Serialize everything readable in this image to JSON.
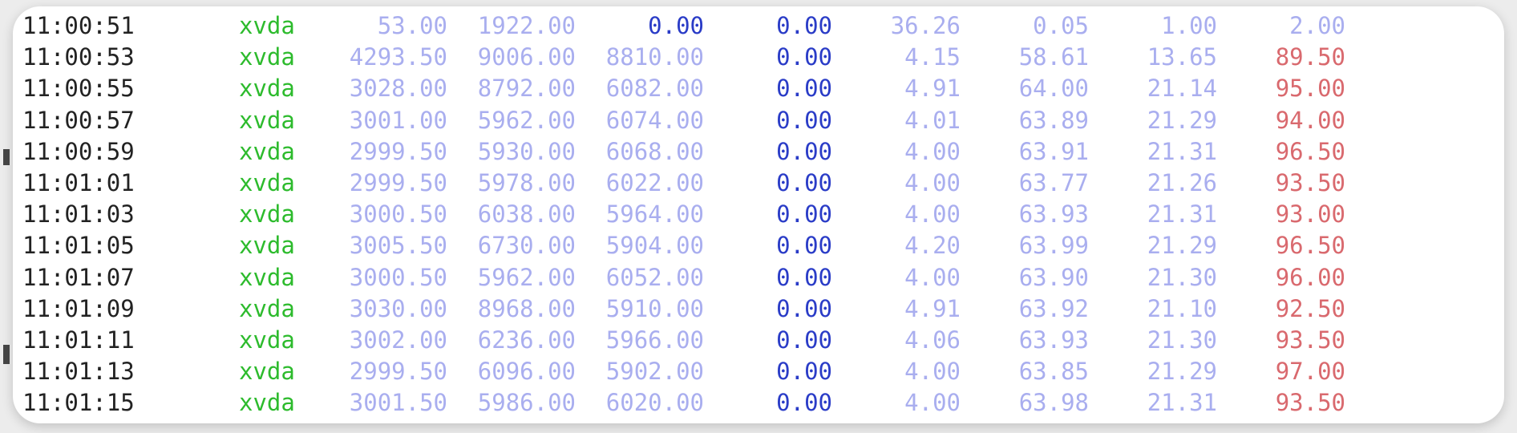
{
  "colors": {
    "time": "#222222",
    "device": "#2dbb2d",
    "dim": "#a9aeef",
    "accent_blue": "#2a3cc7",
    "alert_red": "#d9696e"
  },
  "rows": [
    {
      "time": "11:00:51",
      "device": "xvda",
      "values": [
        "53.00",
        "1922.00",
        "0.00",
        "0.00",
        "36.26",
        "0.05",
        "1.00",
        "2.00"
      ],
      "color_keys": [
        "dim",
        "dim",
        "accent_blue",
        "accent_blue",
        "dim",
        "dim",
        "dim",
        "dim"
      ]
    },
    {
      "time": "11:00:53",
      "device": "xvda",
      "values": [
        "4293.50",
        "9006.00",
        "8810.00",
        "0.00",
        "4.15",
        "58.61",
        "13.65",
        "89.50"
      ],
      "color_keys": [
        "dim",
        "dim",
        "dim",
        "accent_blue",
        "dim",
        "dim",
        "dim",
        "alert_red"
      ]
    },
    {
      "time": "11:00:55",
      "device": "xvda",
      "values": [
        "3028.00",
        "8792.00",
        "6082.00",
        "0.00",
        "4.91",
        "64.00",
        "21.14",
        "95.00"
      ],
      "color_keys": [
        "dim",
        "dim",
        "dim",
        "accent_blue",
        "dim",
        "dim",
        "dim",
        "alert_red"
      ]
    },
    {
      "time": "11:00:57",
      "device": "xvda",
      "values": [
        "3001.00",
        "5962.00",
        "6074.00",
        "0.00",
        "4.01",
        "63.89",
        "21.29",
        "94.00"
      ],
      "color_keys": [
        "dim",
        "dim",
        "dim",
        "accent_blue",
        "dim",
        "dim",
        "dim",
        "alert_red"
      ]
    },
    {
      "time": "11:00:59",
      "device": "xvda",
      "values": [
        "2999.50",
        "5930.00",
        "6068.00",
        "0.00",
        "4.00",
        "63.91",
        "21.31",
        "96.50"
      ],
      "color_keys": [
        "dim",
        "dim",
        "dim",
        "accent_blue",
        "dim",
        "dim",
        "dim",
        "alert_red"
      ]
    },
    {
      "time": "11:01:01",
      "device": "xvda",
      "values": [
        "2999.50",
        "5978.00",
        "6022.00",
        "0.00",
        "4.00",
        "63.77",
        "21.26",
        "93.50"
      ],
      "color_keys": [
        "dim",
        "dim",
        "dim",
        "accent_blue",
        "dim",
        "dim",
        "dim",
        "alert_red"
      ]
    },
    {
      "time": "11:01:03",
      "device": "xvda",
      "values": [
        "3000.50",
        "6038.00",
        "5964.00",
        "0.00",
        "4.00",
        "63.93",
        "21.31",
        "93.00"
      ],
      "color_keys": [
        "dim",
        "dim",
        "dim",
        "accent_blue",
        "dim",
        "dim",
        "dim",
        "alert_red"
      ]
    },
    {
      "time": "11:01:05",
      "device": "xvda",
      "values": [
        "3005.50",
        "6730.00",
        "5904.00",
        "0.00",
        "4.20",
        "63.99",
        "21.29",
        "96.50"
      ],
      "color_keys": [
        "dim",
        "dim",
        "dim",
        "accent_blue",
        "dim",
        "dim",
        "dim",
        "alert_red"
      ]
    },
    {
      "time": "11:01:07",
      "device": "xvda",
      "values": [
        "3000.50",
        "5962.00",
        "6052.00",
        "0.00",
        "4.00",
        "63.90",
        "21.30",
        "96.00"
      ],
      "color_keys": [
        "dim",
        "dim",
        "dim",
        "accent_blue",
        "dim",
        "dim",
        "dim",
        "alert_red"
      ]
    },
    {
      "time": "11:01:09",
      "device": "xvda",
      "values": [
        "3030.00",
        "8968.00",
        "5910.00",
        "0.00",
        "4.91",
        "63.92",
        "21.10",
        "92.50"
      ],
      "color_keys": [
        "dim",
        "dim",
        "dim",
        "accent_blue",
        "dim",
        "dim",
        "dim",
        "alert_red"
      ]
    },
    {
      "time": "11:01:11",
      "device": "xvda",
      "values": [
        "3002.00",
        "6236.00",
        "5966.00",
        "0.00",
        "4.06",
        "63.93",
        "21.30",
        "93.50"
      ],
      "color_keys": [
        "dim",
        "dim",
        "dim",
        "accent_blue",
        "dim",
        "dim",
        "dim",
        "alert_red"
      ]
    },
    {
      "time": "11:01:13",
      "device": "xvda",
      "values": [
        "2999.50",
        "6096.00",
        "5902.00",
        "0.00",
        "4.00",
        "63.85",
        "21.29",
        "97.00"
      ],
      "color_keys": [
        "dim",
        "dim",
        "dim",
        "accent_blue",
        "dim",
        "dim",
        "dim",
        "alert_red"
      ]
    },
    {
      "time": "11:01:15",
      "device": "xvda",
      "values": [
        "3001.50",
        "5986.00",
        "6020.00",
        "0.00",
        "4.00",
        "63.98",
        "21.31",
        "93.50"
      ],
      "color_keys": [
        "dim",
        "dim",
        "dim",
        "accent_blue",
        "dim",
        "dim",
        "dim",
        "alert_red"
      ]
    }
  ]
}
